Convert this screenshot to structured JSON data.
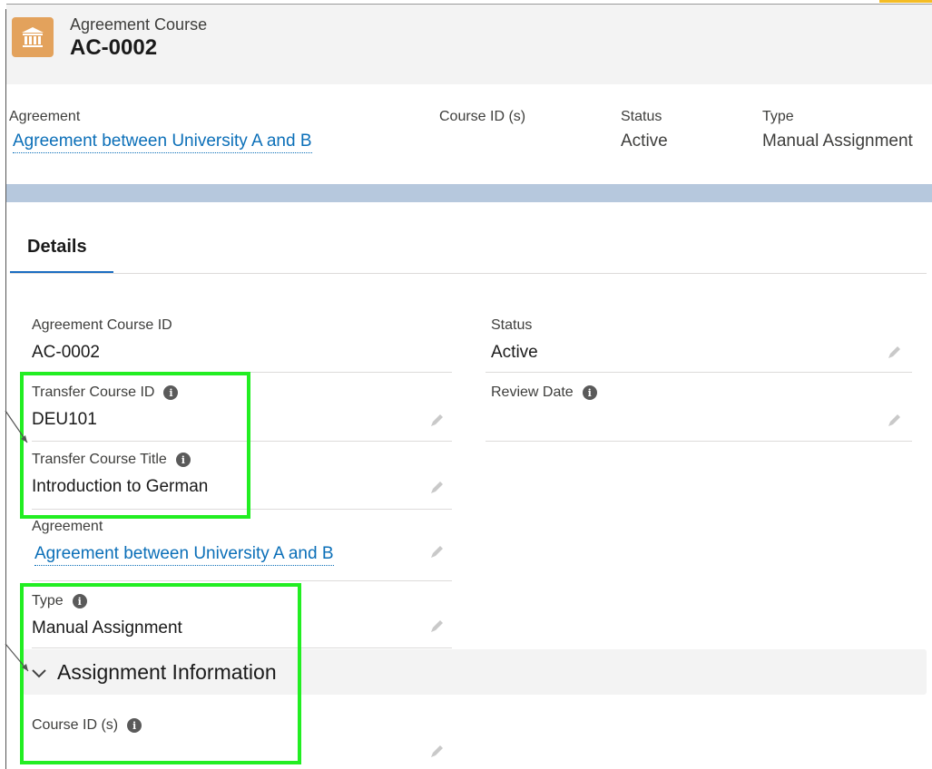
{
  "header": {
    "object_label": "Agreement Course",
    "record_name": "AC-0002",
    "icon": "bank-icon",
    "icon_color": "#e3a25c"
  },
  "highlights": {
    "agreement": {
      "label": "Agreement",
      "value": "Agreement between University A and B"
    },
    "course_ids": {
      "label": "Course ID (s)",
      "value": ""
    },
    "status": {
      "label": "Status",
      "value": "Active"
    },
    "type": {
      "label": "Type",
      "value": "Manual Assignment"
    }
  },
  "tabs": [
    {
      "label": "Details",
      "active": true
    }
  ],
  "details": {
    "agreement_course_id": {
      "label": "Agreement Course ID",
      "value": "AC-0002"
    },
    "status": {
      "label": "Status",
      "value": "Active"
    },
    "transfer_course_id": {
      "label": "Transfer Course ID",
      "value": "DEU101"
    },
    "review_date": {
      "label": "Review Date",
      "value": ""
    },
    "transfer_course_title": {
      "label": "Transfer Course Title",
      "value": "Introduction to German"
    },
    "agreement": {
      "label": "Agreement",
      "value": "Agreement between University A and B"
    },
    "type": {
      "label": "Type",
      "value": "Manual Assignment"
    }
  },
  "section": {
    "title": "Assignment Information",
    "course_ids": {
      "label": "Course ID (s)",
      "value": ""
    }
  },
  "colors": {
    "link": "#0b6fb8",
    "highlight_box": "#22ee22",
    "tab_underline": "#1b6dc1",
    "band": "#b6c8dd"
  }
}
